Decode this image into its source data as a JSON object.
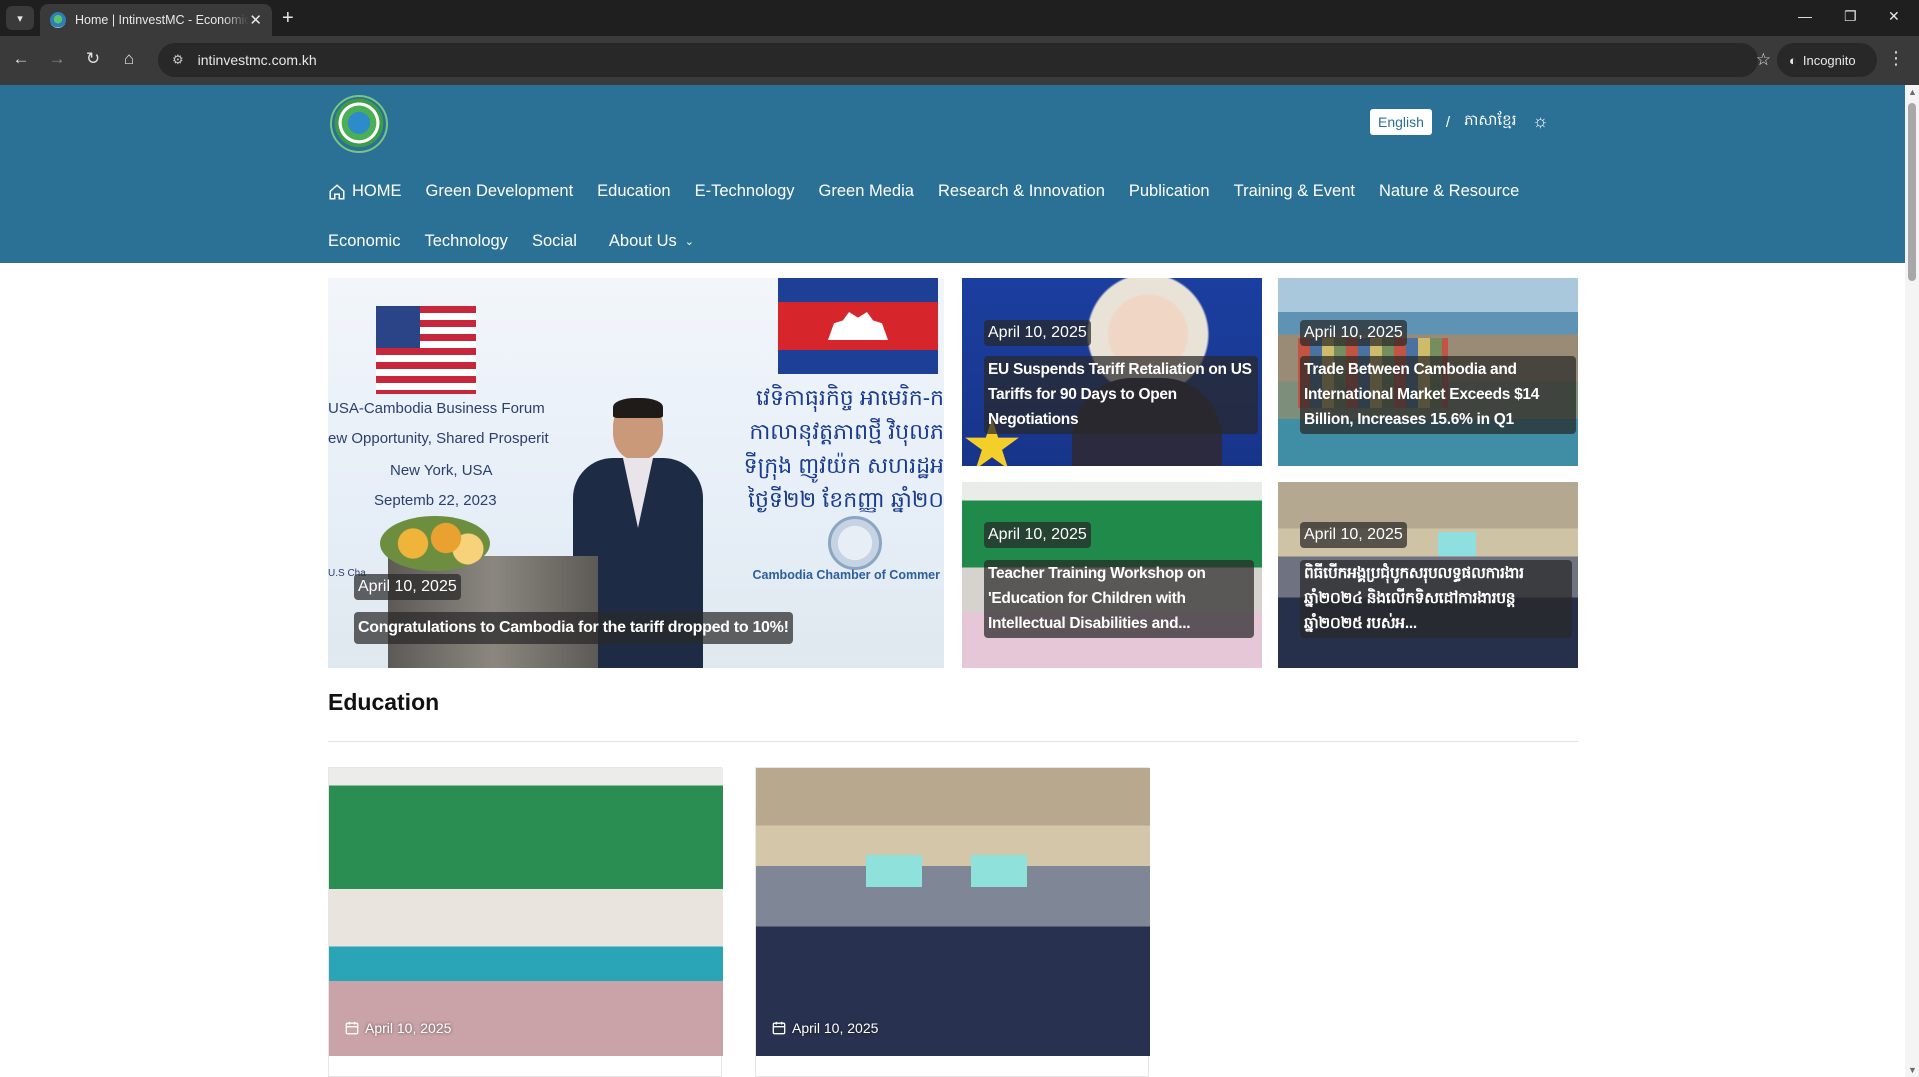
{
  "browser": {
    "tab_title": "Home | IntinvestMC - Economic",
    "url": "intinvestmc.com.kh",
    "incognito_label": "Incognito"
  },
  "header": {
    "lang_en": "English",
    "lang_sep": "/",
    "lang_km": "ភាសាខ្មែរ"
  },
  "nav": {
    "row1": [
      "HOME",
      "Green Development",
      "Education",
      "E-Technology",
      "Green Media",
      "Research & Innovation",
      "Publication",
      "Training & Event",
      "Nature & Resource"
    ],
    "row2": [
      "Economic",
      "Technology",
      "Social",
      "About Us"
    ]
  },
  "banner": {
    "forum": "USA-Cambodia Business Forum",
    "tagline": "ew Opportunity, Shared Prosperit",
    "city": "New York, USA",
    "date": "Septemb  22, 2023",
    "usc": "U.S Cha",
    "khmer": [
      "វេទិកាធុរកិច្ច អាមេរិក-ក",
      "កាលានុវត្តភាពថ្មី វិបុលភ",
      "ទីក្រុង ញូវយ៉ក សហរដ្ឋអ",
      "ថ្ងៃទី២២ ខែកញ្ញា ឆ្នាំ២០"
    ],
    "chamber": "Cambodia Chamber of Commer"
  },
  "featured": [
    {
      "date": "April 10, 2025",
      "title": "Congratulations to Cambodia for the tariff dropped to 10%!"
    },
    {
      "date": "April 10, 2025",
      "title": "EU Suspends Tariff Retaliation on US Tariffs for 90 Days to Open Negotiations"
    },
    {
      "date": "April 10, 2025",
      "title": "Trade Between Cambodia and International Market Exceeds $14 Billion, Increases 15.6% in Q1"
    },
    {
      "date": "April 10, 2025",
      "title": "Teacher Training Workshop on 'Education for Children with Intellectual Disabilities and..."
    },
    {
      "date": "April 10, 2025",
      "title": "ពិធីបើកអង្គប្រជុំបូកសរុបលទ្ធផលការងារ ឆ្នាំ២០២៤ និងលើកទិសដៅការងារបន្ត ឆ្នាំ២០២៥ របស់អ..."
    }
  ],
  "education": {
    "title": "Education",
    "cards": [
      {
        "date": "April 10, 2025"
      },
      {
        "date": "April 10, 2025"
      }
    ]
  },
  "icons": {
    "tab_search": "chevron-down-icon",
    "home": "home-icon",
    "theme": "sun-icon",
    "calendar": "calendar-icon"
  },
  "colors": {
    "header_bg": "#2b7095",
    "browser_dark": "#1f1f1f",
    "toolbar": "#3a3a3a"
  }
}
